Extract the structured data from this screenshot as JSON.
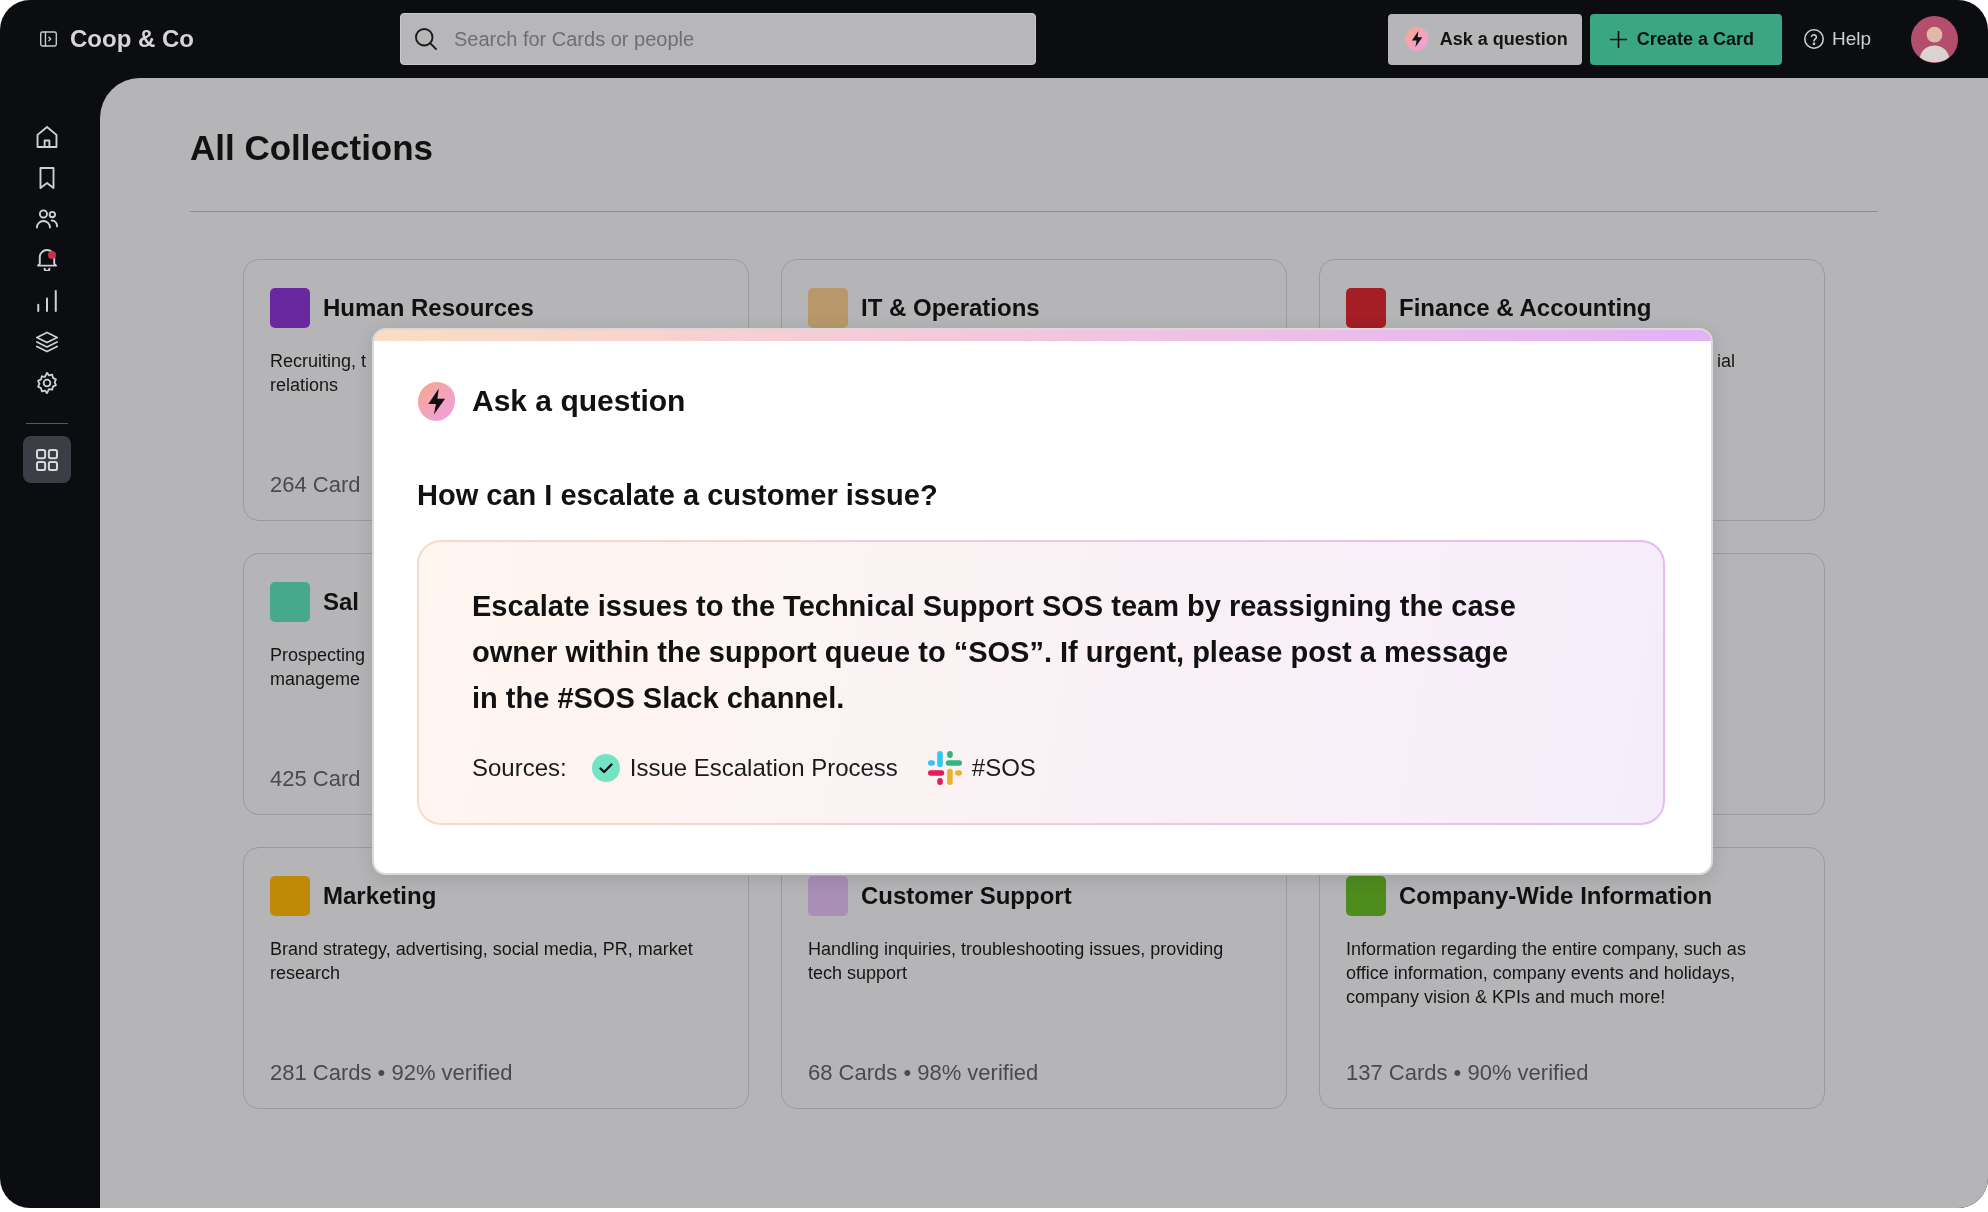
{
  "top_bar": {
    "workspace": "Coop & Co",
    "search": {
      "placeholder": "Search for Cards or people"
    },
    "buttons": [
      {
        "kind": "ask",
        "label": "Ask a question"
      },
      {
        "kind": "create",
        "label": "Create a Card"
      },
      {
        "kind": "help",
        "label": "Help"
      }
    ]
  },
  "sidebar": {
    "items": [
      {
        "kind": "home",
        "selected": false,
        "notification": false
      },
      {
        "kind": "bookmark",
        "selected": false,
        "notification": false
      },
      {
        "kind": "people",
        "selected": false,
        "notification": false
      },
      {
        "kind": "bell",
        "selected": false,
        "notification": true
      },
      {
        "kind": "chart",
        "selected": false,
        "notification": false
      },
      {
        "kind": "layers",
        "selected": false,
        "notification": false
      },
      {
        "kind": "settings",
        "selected": false,
        "notification": false
      }
    ],
    "pinned": [
      {
        "kind": "grid",
        "selected": true,
        "notification": false
      }
    ]
  },
  "page": {
    "title": "All Collections",
    "collection_rows": [
      {
        "cards": [
          {
            "title": "Human Resources",
            "color": "#6a28a0",
            "description_lines": [
              "Recruiting, t",
              "relations"
            ],
            "stats": "264 Card"
          },
          {
            "title": "IT & Operations",
            "color": "#b8976b"
          },
          {
            "title": "Finance & Accounting",
            "color": "#a31e25",
            "description_lines": [
              "ial"
            ]
          }
        ]
      },
      {
        "cards": [
          {
            "title": "Sal",
            "color": "#45a98a",
            "description_lines": [
              "Prospecting",
              "manageme"
            ],
            "stats": "425 Card"
          }
        ]
      },
      {
        "cards": [
          {
            "title": "Marketing",
            "color": "#be8a08",
            "description_lines": [
              "Brand strategy, advertising, social media, PR, market",
              "research"
            ],
            "stats": "281 Cards • 92% verified"
          },
          {
            "title": "Customer Support",
            "color": "#a98fb6",
            "description_lines": [
              "Handling inquiries, troubleshooting issues, providing",
              "tech support"
            ],
            "stats": "68 Cards • 98% verified"
          },
          {
            "title": "Company-Wide Information",
            "color": "#4e8c1e",
            "description_lines": [
              "Information regarding the entire company, such as",
              "office information, company events and holidays,",
              "company vision & KPIs and much more!"
            ],
            "stats": "137 Cards • 90% verified"
          }
        ]
      }
    ]
  },
  "dialog": {
    "title": "Ask a question",
    "question": "How can I escalate a customer issue?",
    "answer": "Escalate issues to the Technical Support SOS team by reassigning the case owner within the support queue to “SOS”. If urgent, please post a message in the #SOS Slack channel.",
    "sources_label": "Sources:",
    "sources": [
      {
        "kind": "card",
        "label": "Issue Escalation Process"
      },
      {
        "kind": "channel",
        "label": "#SOS"
      }
    ]
  }
}
